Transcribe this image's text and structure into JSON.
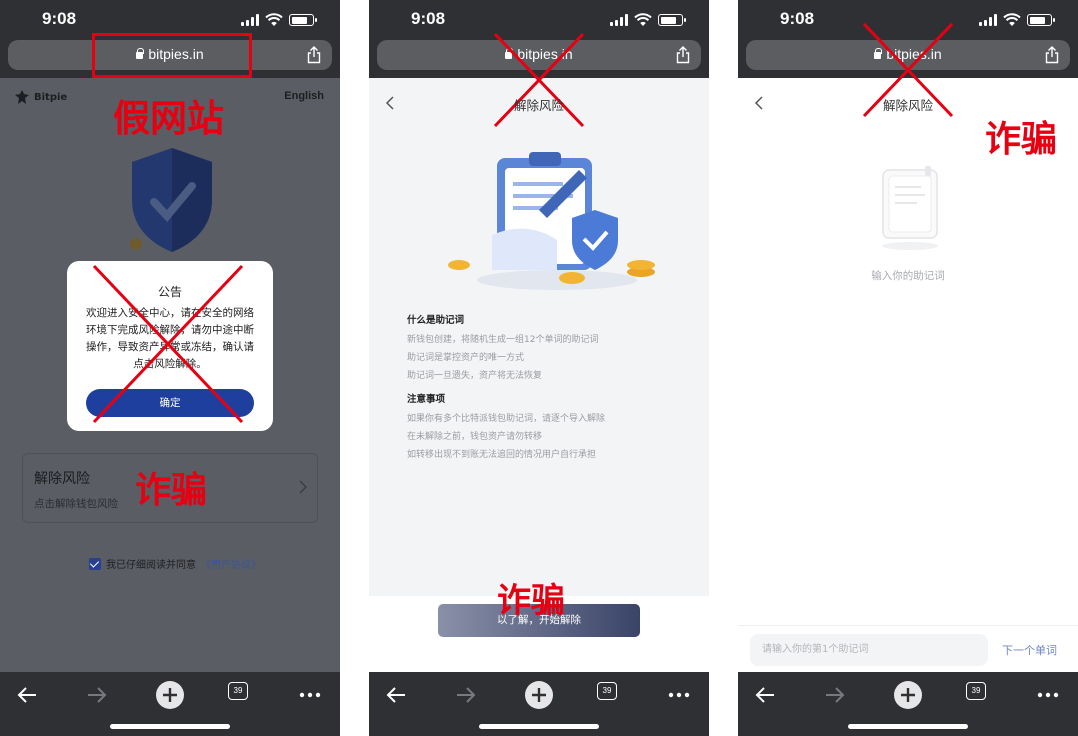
{
  "status_bar": {
    "time": "9:08"
  },
  "browser": {
    "url": "bitpies.in",
    "tab_count": "39"
  },
  "colors": {
    "scam_red": "#e60012",
    "primary_blue": "#1f3f9e",
    "dark_bar": "#2f3033"
  },
  "screen1": {
    "brand": "Bitpie",
    "language": "English",
    "fake_site_label": "假网站",
    "scam_label": "诈骗",
    "dialog": {
      "title": "公告",
      "body": "欢迎进入安全中心，请在安全的网络环境下完成风险解除，请勿中途中断操作，导致资产异常或冻结，确认请点击风险解除。",
      "confirm_button": "确定"
    },
    "risk_card": {
      "title": "解除风险",
      "subtitle": "点击解除钱包风险"
    },
    "agreement": {
      "text": "我已仔细阅读并同意",
      "link": "《用户协议》"
    }
  },
  "screen2": {
    "title": "解除风险",
    "section1": {
      "heading": "什么是助记词",
      "lines": [
        "新钱包创建，将随机生成一组12个单词的助记词",
        "助记词是掌控资产的唯一方式",
        "助记词一旦遗失，资产将无法恢复"
      ]
    },
    "section2": {
      "heading": "注意事项",
      "lines": [
        "如果你有多个比特派钱包助记词，请逐个导入解除",
        "在未解除之前，钱包资产请勿转移",
        "如转移出现不到账无法追回的情况用户自行承担"
      ]
    },
    "start_button": "以了解，开始解除",
    "scam_label": "诈骗"
  },
  "screen3": {
    "title": "解除风险",
    "hint": "输入你的助记词",
    "input_placeholder": "请输入你的第1个助记词",
    "next_button": "下一个单词",
    "scam_label": "诈骗"
  }
}
